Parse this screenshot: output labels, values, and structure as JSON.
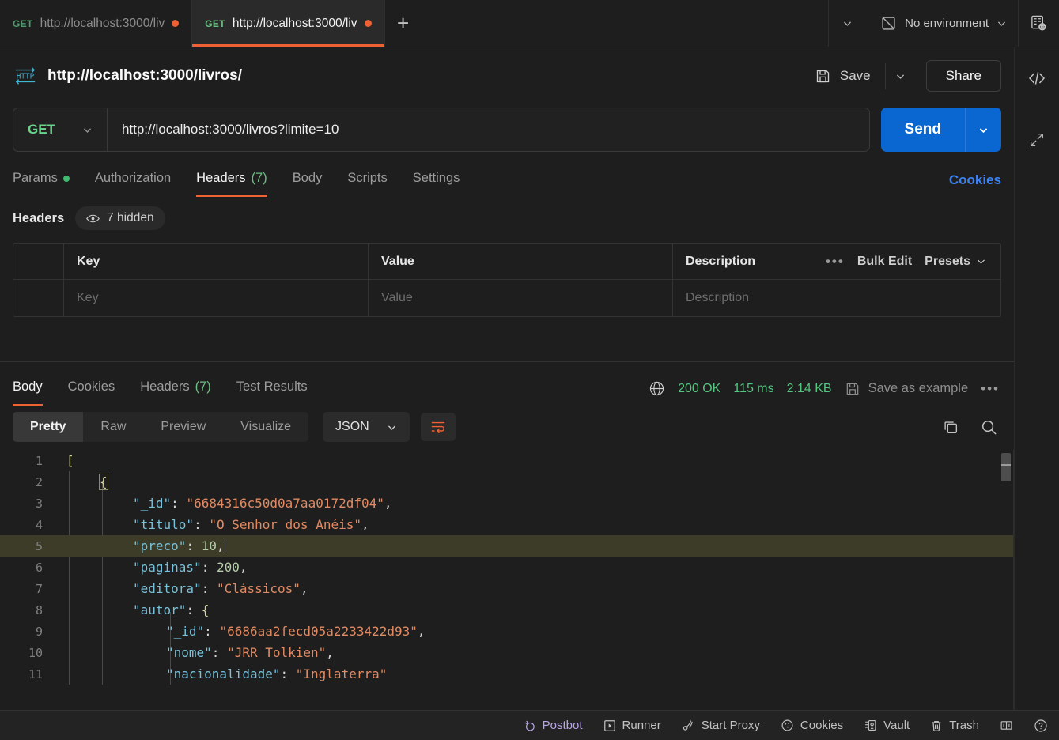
{
  "tabbar": {
    "tabs": [
      {
        "method": "GET",
        "label": "http://localhost:3000/liv",
        "unsaved": true,
        "active": false
      },
      {
        "method": "GET",
        "label": "http://localhost:3000/liv",
        "unsaved": true,
        "active": true
      }
    ],
    "add_label": "+",
    "environment": "No environment"
  },
  "request": {
    "title": "http://localhost:3000/livros/",
    "protocol_badge": "HTTP",
    "save_label": "Save",
    "share_label": "Share",
    "method": "GET",
    "url": "http://localhost:3000/livros?limite=10",
    "send_label": "Send",
    "tabs": [
      {
        "label": "Params",
        "dot": true,
        "count": "",
        "selected": false
      },
      {
        "label": "Authorization",
        "dot": false,
        "count": "",
        "selected": false
      },
      {
        "label": "Headers",
        "dot": false,
        "count": "(7)",
        "selected": true
      },
      {
        "label": "Body",
        "dot": false,
        "count": "",
        "selected": false
      },
      {
        "label": "Scripts",
        "dot": false,
        "count": "",
        "selected": false
      },
      {
        "label": "Settings",
        "dot": false,
        "count": "",
        "selected": false
      }
    ],
    "cookies_link": "Cookies"
  },
  "headers_panel": {
    "title": "Headers",
    "hidden_pill": "7 hidden",
    "columns": [
      "Key",
      "Value",
      "Description"
    ],
    "placeholder_row": [
      "Key",
      "Value",
      "Description"
    ],
    "bulk_edit": "Bulk Edit",
    "presets": "Presets"
  },
  "response": {
    "tabs": [
      {
        "label": "Body",
        "count": "",
        "selected": true
      },
      {
        "label": "Cookies",
        "count": "",
        "selected": false
      },
      {
        "label": "Headers",
        "count": "(7)",
        "selected": false
      },
      {
        "label": "Test Results",
        "count": "",
        "selected": false
      }
    ],
    "status": "200 OK",
    "time": "115 ms",
    "size": "2.14 KB",
    "save_as_example": "Save as example",
    "view_modes": [
      "Pretty",
      "Raw",
      "Preview",
      "Visualize"
    ],
    "view_mode_selected": "Pretty",
    "format": "JSON"
  },
  "code": {
    "lines": [
      {
        "num": "1",
        "indent": 0,
        "highlight": false,
        "tokens": [
          {
            "t": "br",
            "v": "["
          }
        ]
      },
      {
        "num": "2",
        "indent": 1,
        "highlight": false,
        "tokens": [
          {
            "t": "box",
            "v": "{"
          }
        ]
      },
      {
        "num": "3",
        "indent": 2,
        "highlight": false,
        "tokens": [
          {
            "t": "k",
            "v": "\"_id\""
          },
          {
            "t": "p",
            "v": ": "
          },
          {
            "t": "s",
            "v": "\"6684316c50d0a7aa0172df04\""
          },
          {
            "t": "p",
            "v": ","
          }
        ]
      },
      {
        "num": "4",
        "indent": 2,
        "highlight": false,
        "tokens": [
          {
            "t": "k",
            "v": "\"titulo\""
          },
          {
            "t": "p",
            "v": ": "
          },
          {
            "t": "s",
            "v": "\"O Senhor dos Anéis\""
          },
          {
            "t": "p",
            "v": ","
          }
        ]
      },
      {
        "num": "5",
        "indent": 2,
        "highlight": true,
        "tokens": [
          {
            "t": "k",
            "v": "\"preco\""
          },
          {
            "t": "p",
            "v": ": "
          },
          {
            "t": "n",
            "v": "10"
          },
          {
            "t": "p",
            "v": ","
          },
          {
            "t": "caret",
            "v": ""
          }
        ]
      },
      {
        "num": "6",
        "indent": 2,
        "highlight": false,
        "tokens": [
          {
            "t": "k",
            "v": "\"paginas\""
          },
          {
            "t": "p",
            "v": ": "
          },
          {
            "t": "n",
            "v": "200"
          },
          {
            "t": "p",
            "v": ","
          }
        ]
      },
      {
        "num": "7",
        "indent": 2,
        "highlight": false,
        "tokens": [
          {
            "t": "k",
            "v": "\"editora\""
          },
          {
            "t": "p",
            "v": ": "
          },
          {
            "t": "s",
            "v": "\"Clássicos\""
          },
          {
            "t": "p",
            "v": ","
          }
        ]
      },
      {
        "num": "8",
        "indent": 2,
        "highlight": false,
        "tokens": [
          {
            "t": "k",
            "v": "\"autor\""
          },
          {
            "t": "p",
            "v": ": "
          },
          {
            "t": "br",
            "v": "{"
          }
        ]
      },
      {
        "num": "9",
        "indent": 3,
        "highlight": false,
        "tokens": [
          {
            "t": "k",
            "v": "\"_id\""
          },
          {
            "t": "p",
            "v": ": "
          },
          {
            "t": "s",
            "v": "\"6686aa2fecd05a2233422d93\""
          },
          {
            "t": "p",
            "v": ","
          }
        ]
      },
      {
        "num": "10",
        "indent": 3,
        "highlight": false,
        "tokens": [
          {
            "t": "k",
            "v": "\"nome\""
          },
          {
            "t": "p",
            "v": ": "
          },
          {
            "t": "s",
            "v": "\"JRR Tolkien\""
          },
          {
            "t": "p",
            "v": ","
          }
        ]
      },
      {
        "num": "11",
        "indent": 3,
        "highlight": false,
        "tokens": [
          {
            "t": "k",
            "v": "\"nacionalidade\""
          },
          {
            "t": "p",
            "v": ": "
          },
          {
            "t": "s",
            "v": "\"Inglaterra\""
          }
        ]
      }
    ]
  },
  "statusbar": {
    "items": [
      {
        "label": "Postbot",
        "icon": "postbot-icon"
      },
      {
        "label": "Runner",
        "icon": "runner-icon"
      },
      {
        "label": "Start Proxy",
        "icon": "proxy-icon"
      },
      {
        "label": "Cookies",
        "icon": "cookie-icon"
      },
      {
        "label": "Vault",
        "icon": "vault-icon"
      },
      {
        "label": "Trash",
        "icon": "trash-icon"
      }
    ]
  },
  "colors": {
    "accent_orange": "#ef6032",
    "send_blue": "#0a66d0",
    "status_green": "#55c57f",
    "link_blue": "#3b82f6",
    "background": "#1e1e1e"
  }
}
